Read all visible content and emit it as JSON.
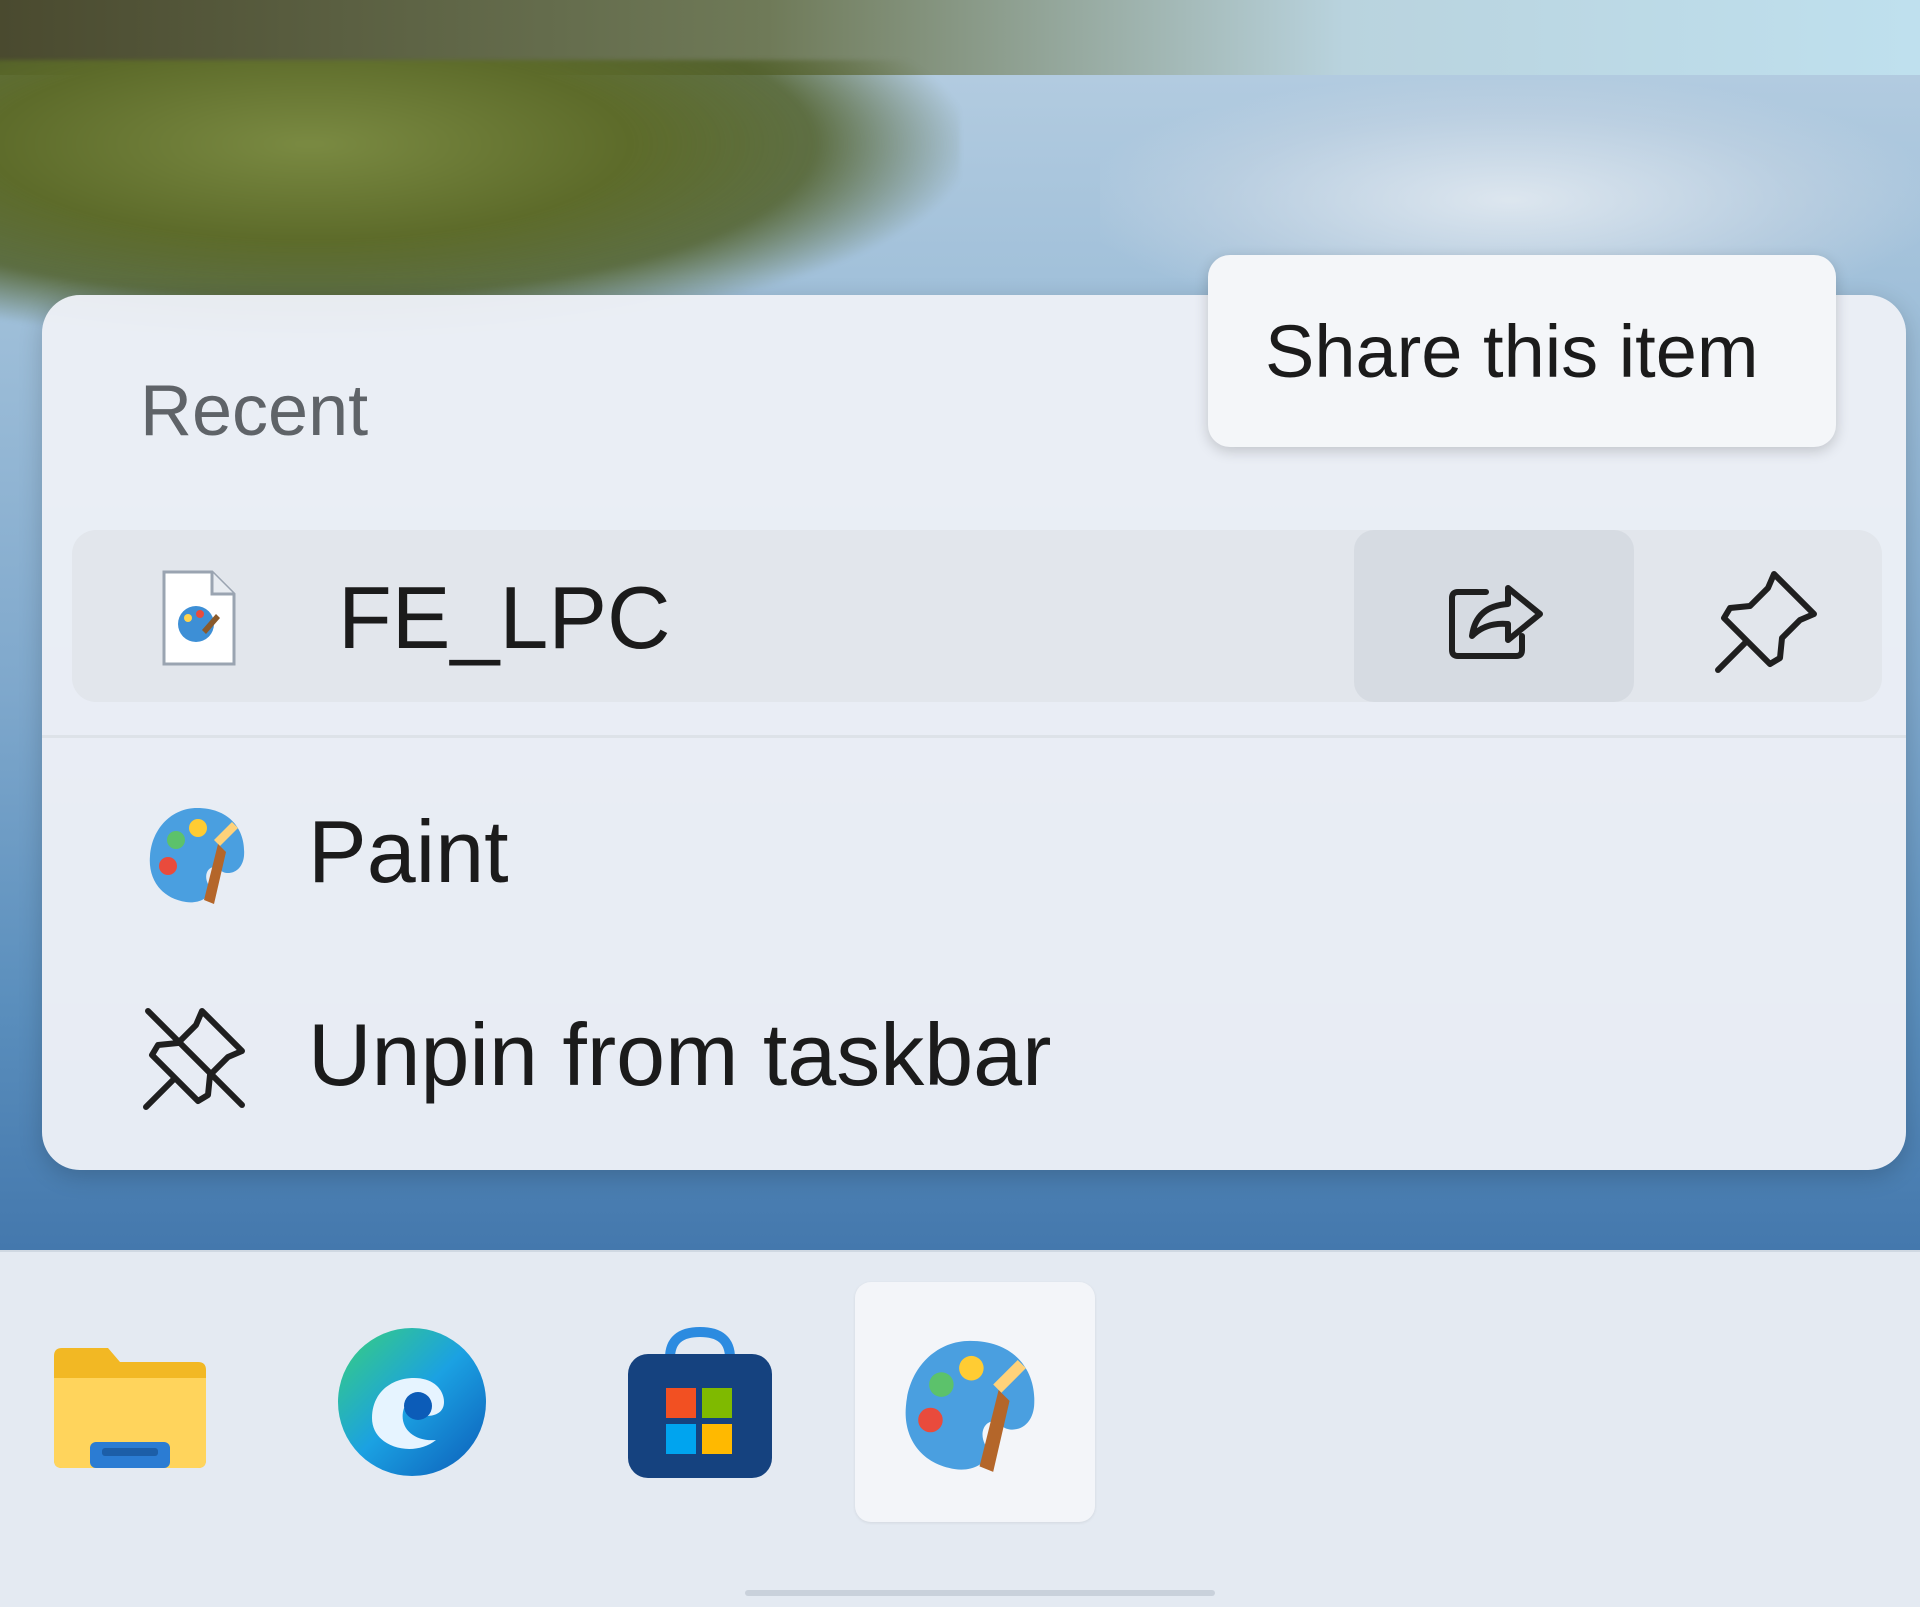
{
  "jumplist": {
    "section_label": "Recent",
    "recent_item": {
      "label": "FE_LPC",
      "icon": "paint-document-icon",
      "share_icon": "share-icon",
      "pin_icon": "pin-icon"
    },
    "tasks": [
      {
        "label": "Paint",
        "icon": "paint-app-icon"
      },
      {
        "label": "Unpin from taskbar",
        "icon": "unpin-icon"
      }
    ]
  },
  "tooltip": {
    "text": "Share this item"
  },
  "taskbar": {
    "apps": [
      {
        "name": "File Explorer",
        "icon": "file-explorer-icon",
        "active": false
      },
      {
        "name": "Microsoft Edge",
        "icon": "edge-icon",
        "active": false
      },
      {
        "name": "Microsoft Store",
        "icon": "store-icon",
        "active": false
      },
      {
        "name": "Paint",
        "icon": "paint-app-icon",
        "active": true
      }
    ]
  },
  "colors": {
    "menu_bg": "#ecf0f6",
    "hover_row": "#e2e6ec",
    "text": "#1b1b1b",
    "muted_text": "#5f6368",
    "taskbar_bg": "#e4eaf2"
  }
}
